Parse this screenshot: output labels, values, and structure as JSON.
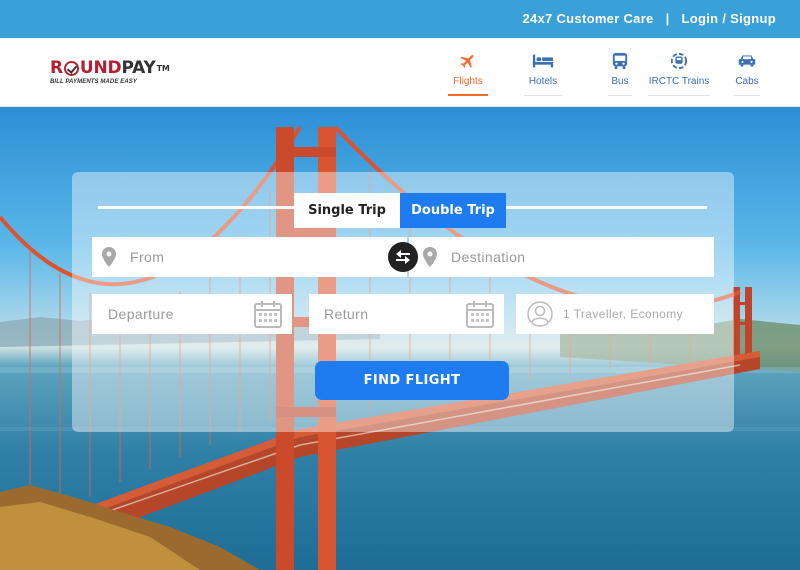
{
  "topbar": {
    "customer_care": "24x7 Customer Care",
    "separator": "|",
    "login": "Login / Signup"
  },
  "logo": {
    "r": "R",
    "und": "UND",
    "pay": "PAY",
    "tm": "TM",
    "tagline": "BILL PAYMENTS MADE EASY"
  },
  "nav": [
    {
      "label": "Flights",
      "icon": "airplane-icon",
      "active": true
    },
    {
      "label": "Hotels",
      "icon": "bed-icon",
      "active": false
    },
    {
      "label": "Bus",
      "icon": "bus-icon",
      "active": false
    },
    {
      "label": "IRCTC Trains",
      "icon": "train-icon",
      "active": false
    },
    {
      "label": "Cabs",
      "icon": "car-icon",
      "active": false
    }
  ],
  "search": {
    "trip_single": "Single Trip",
    "trip_double": "Double Trip",
    "selected_trip": "Double Trip",
    "from_placeholder": "From",
    "destination_placeholder": "Destination",
    "departure_placeholder": "Departure",
    "return_placeholder": "Return",
    "traveller_text": "1 Traveller, Economy",
    "find_button": "FIND FLIGHT"
  },
  "colors": {
    "topbar": "#3aa0d8",
    "accent_blue": "#1f7cf0",
    "active_orange": "#f06b2e",
    "nav_blue": "#3b6fb6",
    "brand_red": "#b81e2e"
  }
}
